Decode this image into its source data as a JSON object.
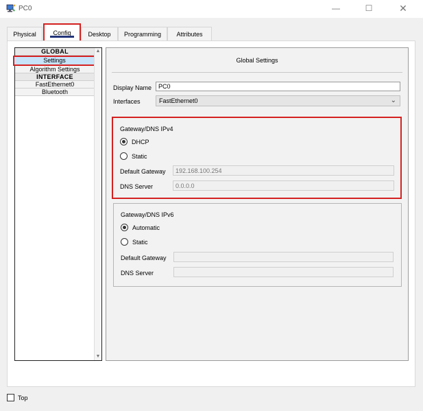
{
  "window": {
    "title": "PC0",
    "controls": {
      "minimize": "—",
      "maximize": "☐",
      "close": "✕"
    }
  },
  "tabs": [
    {
      "label": "Physical"
    },
    {
      "label": "Config",
      "selected": true
    },
    {
      "label": "Desktop"
    },
    {
      "label": "Programming"
    },
    {
      "label": "Attributes"
    }
  ],
  "sidebar": {
    "items": [
      {
        "label": "GLOBAL",
        "type": "header"
      },
      {
        "label": "Settings",
        "selected": true
      },
      {
        "label": "Algorithm Settings"
      },
      {
        "label": "INTERFACE",
        "type": "header"
      },
      {
        "label": "FastEthernet0"
      },
      {
        "label": "Bluetooth"
      }
    ]
  },
  "global_settings": {
    "title": "Global Settings",
    "display_name_label": "Display Name",
    "display_name_value": "PC0",
    "interfaces_label": "Interfaces",
    "interfaces_value": "FastEthernet0"
  },
  "ipv4": {
    "title": "Gateway/DNS IPv4",
    "option_dhcp": "DHCP",
    "option_static": "Static",
    "selected": "DHCP",
    "gateway_label": "Default Gateway",
    "gateway_value": "192.168.100.254",
    "dns_label": "DNS Server",
    "dns_value": "0.0.0.0"
  },
  "ipv6": {
    "title": "Gateway/DNS IPv6",
    "option_auto": "Automatic",
    "option_static": "Static",
    "selected": "Automatic",
    "gateway_label": "Default Gateway",
    "gateway_value": "",
    "dns_label": "DNS Server",
    "dns_value": ""
  },
  "footer": {
    "top_label": "Top",
    "top_checked": false
  },
  "colors": {
    "highlight_red": "#d42020",
    "selected_blue": "#c7e3f9",
    "tab_underline": "#23357a"
  }
}
